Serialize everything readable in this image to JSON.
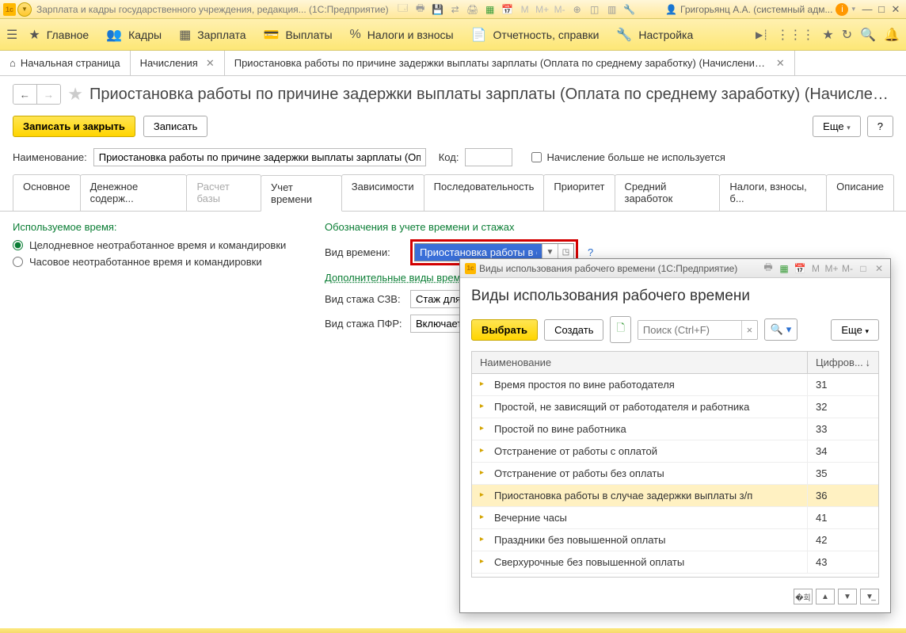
{
  "titlebar": {
    "app_title": "Зарплата и кадры государственного учреждения, редакция...  (1С:Предприятие)",
    "user": "Григорьянц А.А. (системный адм..."
  },
  "mainmenu": {
    "items": [
      {
        "icon": "★",
        "label": "Главное"
      },
      {
        "icon": "👥",
        "label": "Кадры"
      },
      {
        "icon": "▦",
        "label": "Зарплата"
      },
      {
        "icon": "💳",
        "label": "Выплаты"
      },
      {
        "icon": "%",
        "label": "Налоги и взносы"
      },
      {
        "icon": "📄",
        "label": "Отчетность, справки"
      },
      {
        "icon": "🔧",
        "label": "Настройка"
      }
    ]
  },
  "tabs": [
    {
      "label": "Начальная страница",
      "closable": false,
      "home": true
    },
    {
      "label": "Начисления",
      "closable": true
    },
    {
      "label": "Приостановка работы по причине задержки выплаты зарплаты (Оплата по среднему заработку) (Начисление) *",
      "closable": true
    }
  ],
  "page_title": "Приостановка работы по причине задержки выплаты зарплаты (Оплата по среднему заработку) (Начислени...",
  "toolbar": {
    "save_close": "Записать и закрыть",
    "save": "Записать",
    "more": "Еще",
    "help": "?"
  },
  "form": {
    "name_label": "Наименование:",
    "name_value": "Приостановка работы по причине задержки выплаты зарплаты (Опл",
    "code_label": "Код:",
    "code_value": "",
    "not_used_label": "Начисление больше не используется"
  },
  "inner_tabs": [
    "Основное",
    "Денежное содерж...",
    "Расчет базы",
    "Учет времени",
    "Зависимости",
    "Последовательность",
    "Приоритет",
    "Средний заработок",
    "Налоги, взносы, б...",
    "Описание"
  ],
  "time_tab": {
    "used_time_title": "Используемое время:",
    "radio1": "Целодневное неотработанное время и командировки",
    "radio2": "Часовое неотработанное время и командировки",
    "designations_title": "Обозначения в учете времени и стажах",
    "time_kind_label": "Вид времени:",
    "time_kind_value": "Приостановка работы в сл",
    "additional_link": "Дополнительные виды времен",
    "szv_label": "Вид стажа СЗВ:",
    "szv_value": "Стаж для до",
    "pfr_label": "Вид стажа ПФР:",
    "pfr_value": "Включается"
  },
  "dialog": {
    "win_title": "Виды использования рабочего времени  (1С:Предприятие)",
    "heading": "Виды использования рабочего времени",
    "select_btn": "Выбрать",
    "create_btn": "Создать",
    "search_placeholder": "Поиск (Ctrl+F)",
    "more": "Еще",
    "col_name": "Наименование",
    "col_code": "Цифров...",
    "rows": [
      {
        "name": "Время простоя по вине работодателя",
        "code": "31"
      },
      {
        "name": "Простой, не зависящий от работодателя и работника",
        "code": "32"
      },
      {
        "name": "Простой по вине работника",
        "code": "33"
      },
      {
        "name": "Отстранение от работы с оплатой",
        "code": "34"
      },
      {
        "name": "Отстранение от работы без оплаты",
        "code": "35"
      },
      {
        "name": "Приостановка работы в случае задержки выплаты з/п",
        "code": "36",
        "selected": true
      },
      {
        "name": "Вечерние часы",
        "code": "41"
      },
      {
        "name": "Праздники без повышенной оплаты",
        "code": "42"
      },
      {
        "name": "Сверхурочные без повышенной оплаты",
        "code": "43"
      }
    ]
  }
}
